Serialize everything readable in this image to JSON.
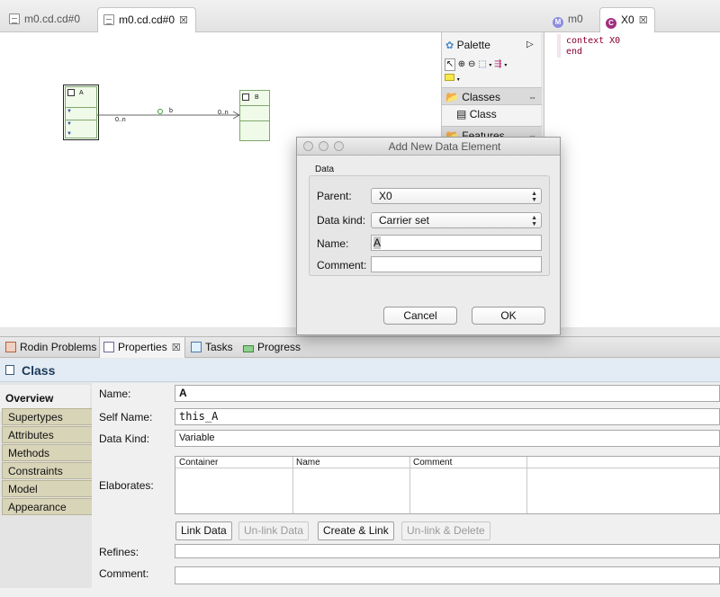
{
  "editor": {
    "tabs": [
      {
        "label": "m0.cd.cd#0",
        "active": false
      },
      {
        "label": "m0.cd.cd#0",
        "active": true
      }
    ]
  },
  "diagram": {
    "class_a": {
      "name": "A"
    },
    "class_b": {
      "name": "B"
    },
    "association": {
      "name": "b",
      "source_multiplicity": "0..n",
      "target_multiplicity": "0..n"
    }
  },
  "palette": {
    "title": "Palette",
    "groups": [
      {
        "label": "Classes",
        "items": [
          "Class"
        ]
      },
      {
        "label": "Features"
      }
    ]
  },
  "text_editor": {
    "tabs": [
      {
        "label": "m0",
        "active": false
      },
      {
        "label": "X0",
        "active": true
      }
    ],
    "lines": [
      "context X0",
      "end"
    ]
  },
  "dialog": {
    "title": "Add New Data Element",
    "group_label": "Data",
    "fields": {
      "parent": {
        "label": "Parent:",
        "value": "X0"
      },
      "data_kind": {
        "label": "Data kind:",
        "value": "Carrier set"
      },
      "name": {
        "label": "Name:",
        "value": "A"
      },
      "comment": {
        "label": "Comment:",
        "value": ""
      }
    },
    "buttons": {
      "cancel": "Cancel",
      "ok": "OK"
    }
  },
  "bottom_views": {
    "tabs": [
      {
        "label": "Rodin Problems",
        "active": false
      },
      {
        "label": "Properties",
        "active": true
      },
      {
        "label": "Tasks",
        "active": false
      },
      {
        "label": "Progress",
        "active": false
      }
    ]
  },
  "properties": {
    "title": "Class",
    "sections": [
      "Overview",
      "Supertypes",
      "Attributes",
      "Methods",
      "Constraints",
      "Model",
      "Appearance"
    ],
    "fields": {
      "name": {
        "label": "Name:",
        "value": "A"
      },
      "self_name": {
        "label": "Self Name:",
        "value": "this_A"
      },
      "data_kind": {
        "label": "Data Kind:",
        "value": "Variable"
      },
      "elaborates": {
        "label": "Elaborates:"
      },
      "refines": {
        "label": "Refines:",
        "value": ""
      },
      "comment": {
        "label": "Comment:",
        "value": ""
      }
    },
    "elaborates_table": {
      "columns": [
        "Container",
        "Name",
        "Comment"
      ]
    },
    "buttons": [
      {
        "label": "Link Data",
        "enabled": true
      },
      {
        "label": "Un-link Data",
        "enabled": false
      },
      {
        "label": "Create & Link",
        "enabled": true
      },
      {
        "label": "Un-link & Delete",
        "enabled": false
      }
    ]
  },
  "colors": {
    "class_fill": "#f0fae9",
    "class_border": "#7da86c",
    "sidetab_fill": "#d8d4b8",
    "keyword": "#8b0032",
    "title_bar": "#e3ecf4"
  }
}
